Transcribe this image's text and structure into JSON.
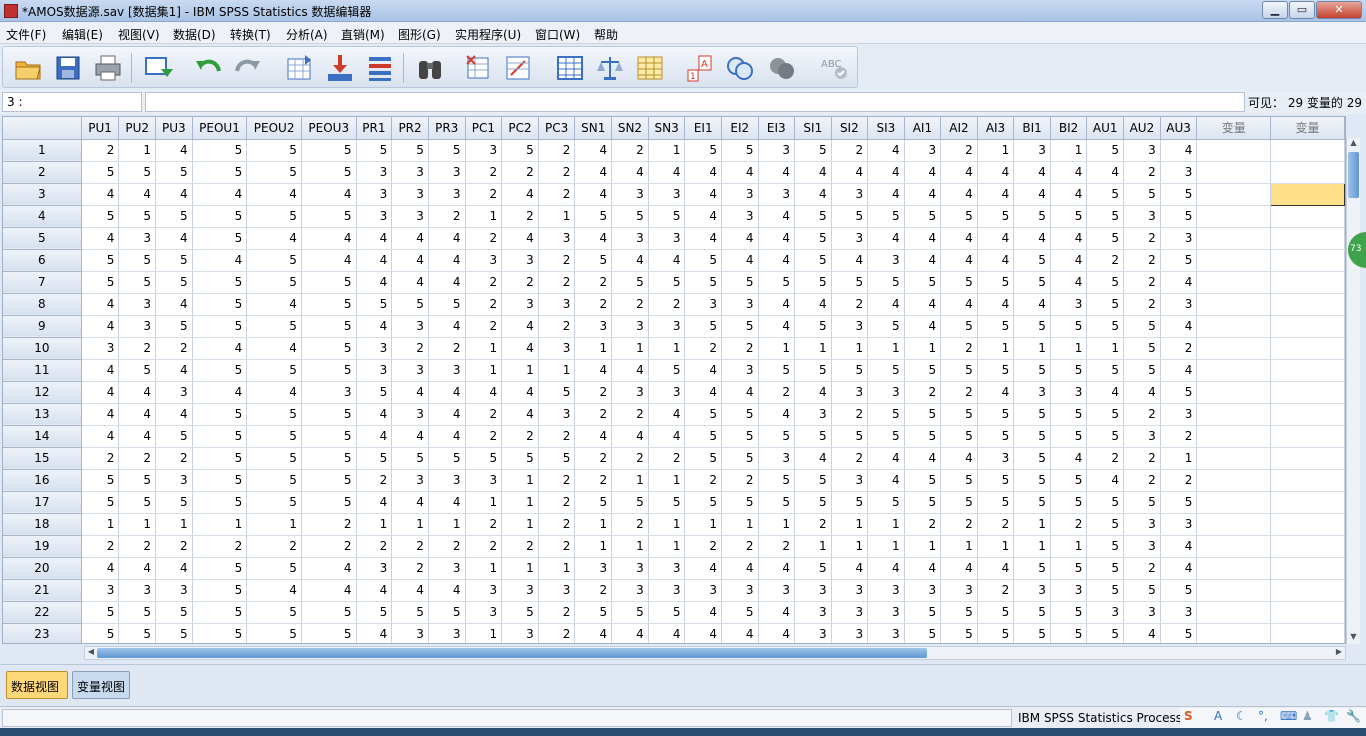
{
  "window": {
    "title": "*AMOS数据源.sav [数据集1] - IBM SPSS Statistics 数据编辑器",
    "minimize": "▁",
    "maximize": "▭",
    "close": "✕"
  },
  "menu": [
    "文件(F)",
    "编辑(E)",
    "视图(V)",
    "数据(D)",
    "转换(T)",
    "分析(A)",
    "直销(M)",
    "图形(G)",
    "实用程序(U)",
    "窗口(W)",
    "帮助"
  ],
  "cell": {
    "ref": "3 :",
    "value": ""
  },
  "visible_info": "可见： 29 变量的 29",
  "columns": [
    "PU1",
    "PU2",
    "PU3",
    "PEOU1",
    "PEOU2",
    "PEOU3",
    "PR1",
    "PR2",
    "PR3",
    "PC1",
    "PC2",
    "PC3",
    "SN1",
    "SN2",
    "SN3",
    "EI1",
    "EI2",
    "EI3",
    "SI1",
    "SI2",
    "SI3",
    "AI1",
    "AI2",
    "AI3",
    "BI1",
    "BI2",
    "AU1",
    "AU2",
    "AU3"
  ],
  "empty_columns": [
    "变量",
    "变量"
  ],
  "rows": [
    [
      2,
      1,
      4,
      5,
      5,
      5,
      5,
      5,
      5,
      3,
      5,
      2,
      4,
      2,
      1,
      5,
      5,
      3,
      5,
      2,
      4,
      3,
      2,
      1,
      3,
      1,
      5,
      3,
      4
    ],
    [
      5,
      5,
      5,
      5,
      5,
      5,
      3,
      3,
      3,
      2,
      2,
      2,
      4,
      4,
      4,
      4,
      4,
      4,
      4,
      4,
      4,
      4,
      4,
      4,
      4,
      4,
      4,
      2,
      3
    ],
    [
      4,
      4,
      4,
      4,
      4,
      4,
      3,
      3,
      3,
      2,
      4,
      2,
      4,
      3,
      3,
      4,
      3,
      3,
      4,
      3,
      4,
      4,
      4,
      4,
      4,
      4,
      5,
      5,
      5
    ],
    [
      5,
      5,
      5,
      5,
      5,
      5,
      3,
      3,
      2,
      1,
      2,
      1,
      5,
      5,
      5,
      4,
      3,
      4,
      5,
      5,
      5,
      5,
      5,
      5,
      5,
      5,
      5,
      3,
      5
    ],
    [
      4,
      3,
      4,
      5,
      4,
      4,
      4,
      4,
      4,
      2,
      4,
      3,
      4,
      3,
      3,
      4,
      4,
      4,
      5,
      3,
      4,
      4,
      4,
      4,
      4,
      4,
      5,
      2,
      3
    ],
    [
      5,
      5,
      5,
      4,
      5,
      4,
      4,
      4,
      4,
      3,
      3,
      2,
      5,
      4,
      4,
      5,
      4,
      4,
      5,
      4,
      3,
      4,
      4,
      4,
      5,
      4,
      2,
      2,
      5
    ],
    [
      5,
      5,
      5,
      5,
      5,
      5,
      4,
      4,
      4,
      2,
      2,
      2,
      2,
      5,
      5,
      5,
      5,
      5,
      5,
      5,
      5,
      5,
      5,
      5,
      5,
      4,
      5,
      2,
      4
    ],
    [
      4,
      3,
      4,
      5,
      4,
      5,
      5,
      5,
      5,
      2,
      3,
      3,
      2,
      2,
      2,
      3,
      3,
      4,
      4,
      2,
      4,
      4,
      4,
      4,
      4,
      3,
      5,
      2,
      3
    ],
    [
      4,
      3,
      5,
      5,
      5,
      5,
      4,
      3,
      4,
      2,
      4,
      2,
      3,
      3,
      3,
      5,
      5,
      4,
      5,
      3,
      5,
      4,
      5,
      5,
      5,
      5,
      5,
      5,
      4
    ],
    [
      3,
      2,
      2,
      4,
      4,
      5,
      3,
      2,
      2,
      1,
      4,
      3,
      1,
      1,
      1,
      2,
      2,
      1,
      1,
      1,
      1,
      1,
      2,
      1,
      1,
      1,
      1,
      5,
      2
    ],
    [
      4,
      5,
      4,
      5,
      5,
      5,
      3,
      3,
      3,
      1,
      1,
      1,
      4,
      4,
      5,
      4,
      3,
      5,
      5,
      5,
      5,
      5,
      5,
      5,
      5,
      5,
      5,
      5,
      4
    ],
    [
      4,
      4,
      3,
      4,
      4,
      3,
      5,
      4,
      4,
      4,
      4,
      5,
      2,
      3,
      3,
      4,
      4,
      2,
      4,
      3,
      3,
      2,
      2,
      4,
      3,
      3,
      4,
      4,
      5
    ],
    [
      4,
      4,
      4,
      5,
      5,
      5,
      4,
      3,
      4,
      2,
      4,
      3,
      2,
      2,
      4,
      5,
      5,
      4,
      3,
      2,
      5,
      5,
      5,
      5,
      5,
      5,
      5,
      2,
      3
    ],
    [
      4,
      4,
      5,
      5,
      5,
      5,
      4,
      4,
      4,
      2,
      2,
      2,
      4,
      4,
      4,
      5,
      5,
      5,
      5,
      5,
      5,
      5,
      5,
      5,
      5,
      5,
      5,
      3,
      2
    ],
    [
      2,
      2,
      2,
      5,
      5,
      5,
      5,
      5,
      5,
      5,
      5,
      5,
      2,
      2,
      2,
      5,
      5,
      3,
      4,
      2,
      4,
      4,
      4,
      3,
      5,
      4,
      2,
      2,
      1
    ],
    [
      5,
      5,
      3,
      5,
      5,
      5,
      2,
      3,
      3,
      3,
      1,
      2,
      2,
      1,
      1,
      2,
      2,
      5,
      5,
      3,
      4,
      5,
      5,
      5,
      5,
      5,
      4,
      2,
      2
    ],
    [
      5,
      5,
      5,
      5,
      5,
      5,
      4,
      4,
      4,
      1,
      1,
      2,
      5,
      5,
      5,
      5,
      5,
      5,
      5,
      5,
      5,
      5,
      5,
      5,
      5,
      5,
      5,
      5,
      5
    ],
    [
      1,
      1,
      1,
      1,
      1,
      2,
      1,
      1,
      1,
      2,
      1,
      2,
      1,
      2,
      1,
      1,
      1,
      1,
      2,
      1,
      1,
      2,
      2,
      2,
      1,
      2,
      5,
      3,
      3
    ],
    [
      2,
      2,
      2,
      2,
      2,
      2,
      2,
      2,
      2,
      2,
      2,
      2,
      1,
      1,
      1,
      2,
      2,
      2,
      1,
      1,
      1,
      1,
      1,
      1,
      1,
      1,
      5,
      3,
      4
    ],
    [
      4,
      4,
      4,
      5,
      5,
      4,
      3,
      2,
      3,
      1,
      1,
      1,
      3,
      3,
      3,
      4,
      4,
      4,
      5,
      4,
      4,
      4,
      4,
      4,
      5,
      5,
      5,
      2,
      4
    ],
    [
      3,
      3,
      3,
      5,
      4,
      4,
      4,
      4,
      4,
      3,
      3,
      3,
      2,
      3,
      3,
      3,
      3,
      3,
      3,
      3,
      3,
      3,
      3,
      2,
      3,
      3,
      5,
      5,
      5
    ],
    [
      5,
      5,
      5,
      5,
      5,
      5,
      5,
      5,
      5,
      3,
      5,
      2,
      5,
      5,
      5,
      4,
      5,
      4,
      3,
      3,
      3,
      5,
      5,
      5,
      5,
      5,
      3,
      3,
      3
    ],
    [
      5,
      5,
      5,
      5,
      5,
      5,
      4,
      3,
      3,
      1,
      3,
      2,
      4,
      4,
      4,
      4,
      4,
      4,
      3,
      3,
      3,
      5,
      5,
      5,
      5,
      5,
      5,
      4,
      5
    ]
  ],
  "tabs": {
    "data_view": "数据视图",
    "variable_view": "变量视图"
  },
  "status": {
    "processor": "IBM SPSS Statistics Processor"
  },
  "ime": [
    "S",
    "A",
    "☾",
    "°,",
    "⌨",
    "♟",
    "👕",
    "🔧"
  ],
  "side_badge": "73"
}
